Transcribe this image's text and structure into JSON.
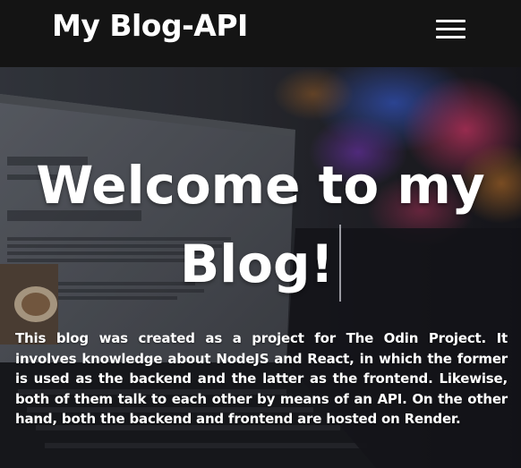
{
  "navbar": {
    "brand": "My Blog-API",
    "menu_icon": "hamburger-menu-icon"
  },
  "hero": {
    "title_line_1": "Welcome to my",
    "title_line_2": "Blog!",
    "description": "This blog was created as a project for The Odin Project. It involves knowledge about NodeJS and React, in which the former is used as the backend and the latter as the frontend. Likewise, both of them talk to each other by means of an API. On the other hand, both the backend and frontend are hosted on Render."
  },
  "colors": {
    "navbar_bg": "#141414",
    "text": "#ffffff"
  }
}
